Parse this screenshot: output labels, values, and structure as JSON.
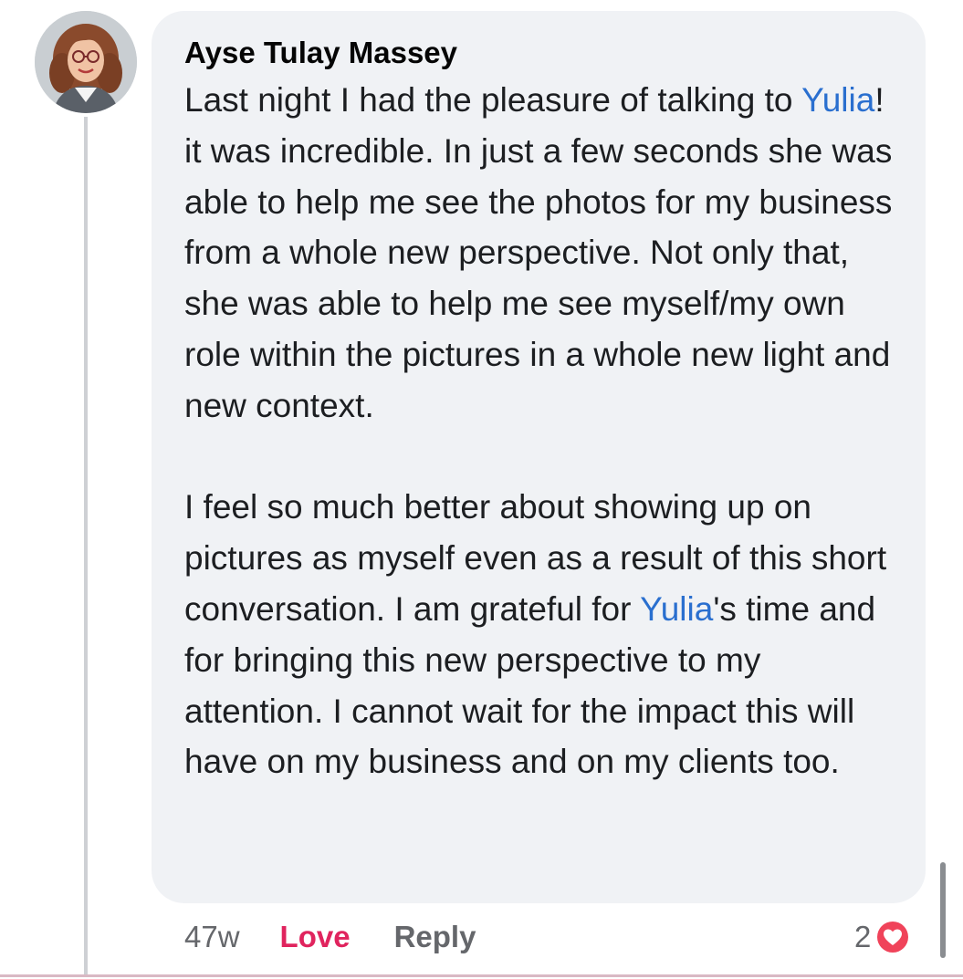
{
  "comment": {
    "author": "Ayse Tulay Massey",
    "paragraph1": {
      "part1": "Last night I had the pleasure of talking to ",
      "mention": "Yulia",
      "part2": "! it was incredible. In just a few seconds she was able to help me see the photos for my business from a whole new perspective. Not only that, she was able to help me see myself/my own role within the pictures in a whole new light and new context."
    },
    "paragraph2": {
      "part1": "I feel so much better about showing up on pictures as myself even as a result of this short conversation. I am grateful for ",
      "mention": "Yulia",
      "part2": "'s time and for bringing this new perspective to my attention. I cannot wait for the impact this will have on my business and on my clients too."
    }
  },
  "actions": {
    "timestamp": "47w",
    "love_label": "Love",
    "reply_label": "Reply"
  },
  "reactions": {
    "count": "2",
    "icon": "heart-icon"
  },
  "colors": {
    "bubble": "#f0f2f5",
    "mention": "#2a6fcf",
    "love": "#e0245e",
    "muted": "#65676b"
  }
}
